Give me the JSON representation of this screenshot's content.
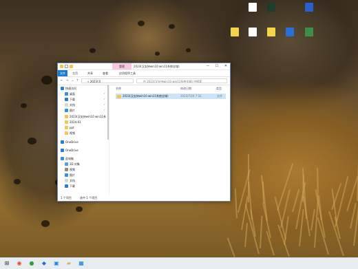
{
  "desktop": {
    "icons": [
      {
        "label": "",
        "color": "#ffffff",
        "icon": "document-icon"
      },
      {
        "label": "",
        "color": "#1f3b2a",
        "icon": "terminal-app-icon"
      },
      {
        "label": "",
        "color": "#2a5fcf",
        "icon": "computer-app-icon"
      },
      {
        "label": "",
        "color": "#f2d34a",
        "icon": "folder-icon"
      },
      {
        "label": "",
        "color": "#ffffff",
        "icon": "text-file-icon"
      },
      {
        "label": "",
        "color": "#f2d34a",
        "icon": "folder-icon"
      },
      {
        "label": "",
        "color": "#2a6fd8",
        "icon": "computer-app-icon"
      },
      {
        "label": "",
        "color": "#3b8f4a",
        "icon": "green-app-icon"
      }
    ]
  },
  "window": {
    "title": "2023(汉支持win10 win11系统全域)",
    "context_tab": "管理",
    "ribbon_tabs": [
      "文件",
      "主页",
      "共享",
      "查看",
      "应用程序工具"
    ],
    "address": "2023(汉... ",
    "address_short": "« 2023(汉",
    "search_placeholder": "在 2023(汉支持win10 win11系统全域) 中搜索",
    "controls": {
      "minimize": "—",
      "maximize": "☐",
      "close": "✕"
    },
    "nav_items": [
      {
        "label": "快速访问",
        "color": "#2a7fd4",
        "pinned": false
      },
      {
        "label": "桌面",
        "color": "#3a90d8",
        "pinned": true
      },
      {
        "label": "下载",
        "color": "#2a7fd4",
        "pinned": true
      },
      {
        "label": "文档",
        "color": "#cfd8e0",
        "pinned": true
      },
      {
        "label": "图片",
        "color": "#3a90d8",
        "pinned": true
      },
      {
        "label": "2023(汉支持win10 win11系",
        "color": "#f3c65b",
        "pinned": false
      },
      {
        "label": "2024-01",
        "color": "#f3c65b",
        "pinned": false
      },
      {
        "label": "ppt",
        "color": "#f3c65b",
        "pinned": false
      },
      {
        "label": "视频",
        "color": "#f3c65b",
        "pinned": false
      },
      {
        "label": "OneDrive",
        "color": "#2b7bd9",
        "pinned": false
      },
      {
        "label": "OneDrive",
        "color": "#2b7bd9",
        "pinned": false
      },
      {
        "label": "此电脑",
        "color": "#3a90d8",
        "pinned": false
      },
      {
        "label": "3D 对象",
        "color": "#5aa0d8",
        "pinned": false
      },
      {
        "label": "视频",
        "color": "#8a8a8a",
        "pinned": false
      },
      {
        "label": "图片",
        "color": "#3a90d8",
        "pinned": false
      },
      {
        "label": "文档",
        "color": "#cfd8e0",
        "pinned": false
      },
      {
        "label": "下载",
        "color": "#2a7fd4",
        "pinned": false
      }
    ],
    "pin_glyph": "✓",
    "columns": {
      "name": "名称",
      "date": "修改日期",
      "type": "类型"
    },
    "files": [
      {
        "name": "2023(汉支持win10 win11系统全域)",
        "date": "2022/7/24 7:31",
        "type": "文件"
      }
    ],
    "status": {
      "count": "1 个项目",
      "selected": "选中 1 个项目"
    }
  },
  "taskbar": {
    "icons": [
      {
        "name": "start-button",
        "glyph": "⊞",
        "color": "#333333"
      },
      {
        "name": "browser-app",
        "glyph": "◉",
        "color": "#e64a2e"
      },
      {
        "name": "app-green",
        "glyph": "●",
        "color": "#2f9e44"
      },
      {
        "name": "app-blue",
        "glyph": "◆",
        "color": "#2a6fd8"
      },
      {
        "name": "app-tv",
        "glyph": "▣",
        "color": "#1e88e5"
      },
      {
        "name": "file-explorer",
        "glyph": "▰",
        "color": "#e0b34a"
      },
      {
        "name": "app-store",
        "glyph": "▦",
        "color": "#1979ca"
      }
    ]
  }
}
